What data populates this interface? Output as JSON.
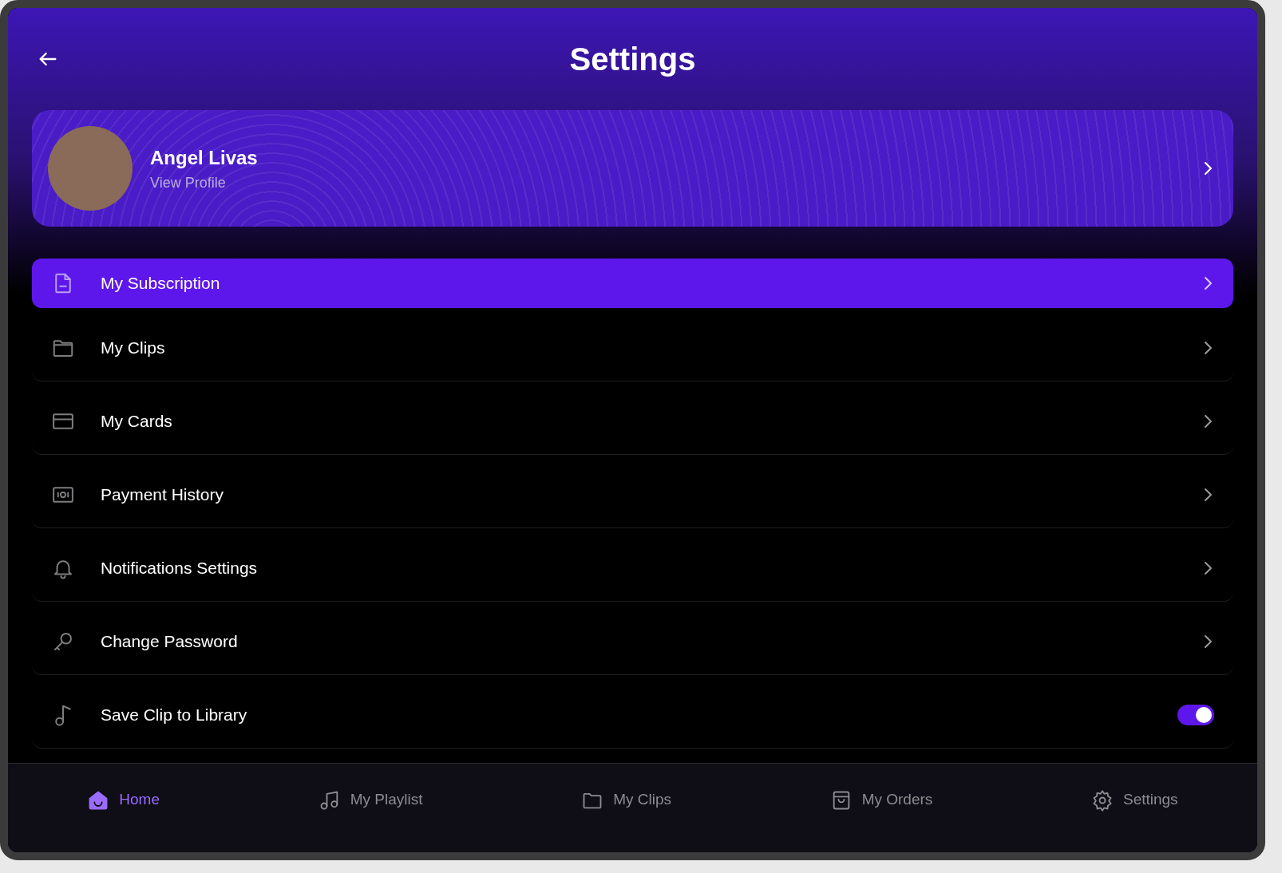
{
  "header": {
    "title": "Settings"
  },
  "profile": {
    "name": "Angel Livas",
    "link": "View Profile"
  },
  "menu": [
    {
      "kind": "link",
      "label": "My Subscription",
      "selected": true
    },
    {
      "kind": "link",
      "label": "My Clips",
      "selected": false
    },
    {
      "kind": "link",
      "label": "My Cards",
      "selected": false
    },
    {
      "kind": "link",
      "label": "Payment History",
      "selected": false
    },
    {
      "kind": "link",
      "label": "Notifications Settings",
      "selected": false
    },
    {
      "kind": "link",
      "label": "Change Password",
      "selected": false
    },
    {
      "kind": "toggle",
      "label": "Save Clip to Library",
      "on": true
    }
  ],
  "bottom_nav": [
    {
      "label": "Home",
      "selected": true
    },
    {
      "label": "My Playlist",
      "selected": false
    },
    {
      "label": "My Clips",
      "selected": false
    },
    {
      "label": "My Orders",
      "selected": false
    },
    {
      "label": "Settings",
      "selected": false
    }
  ]
}
